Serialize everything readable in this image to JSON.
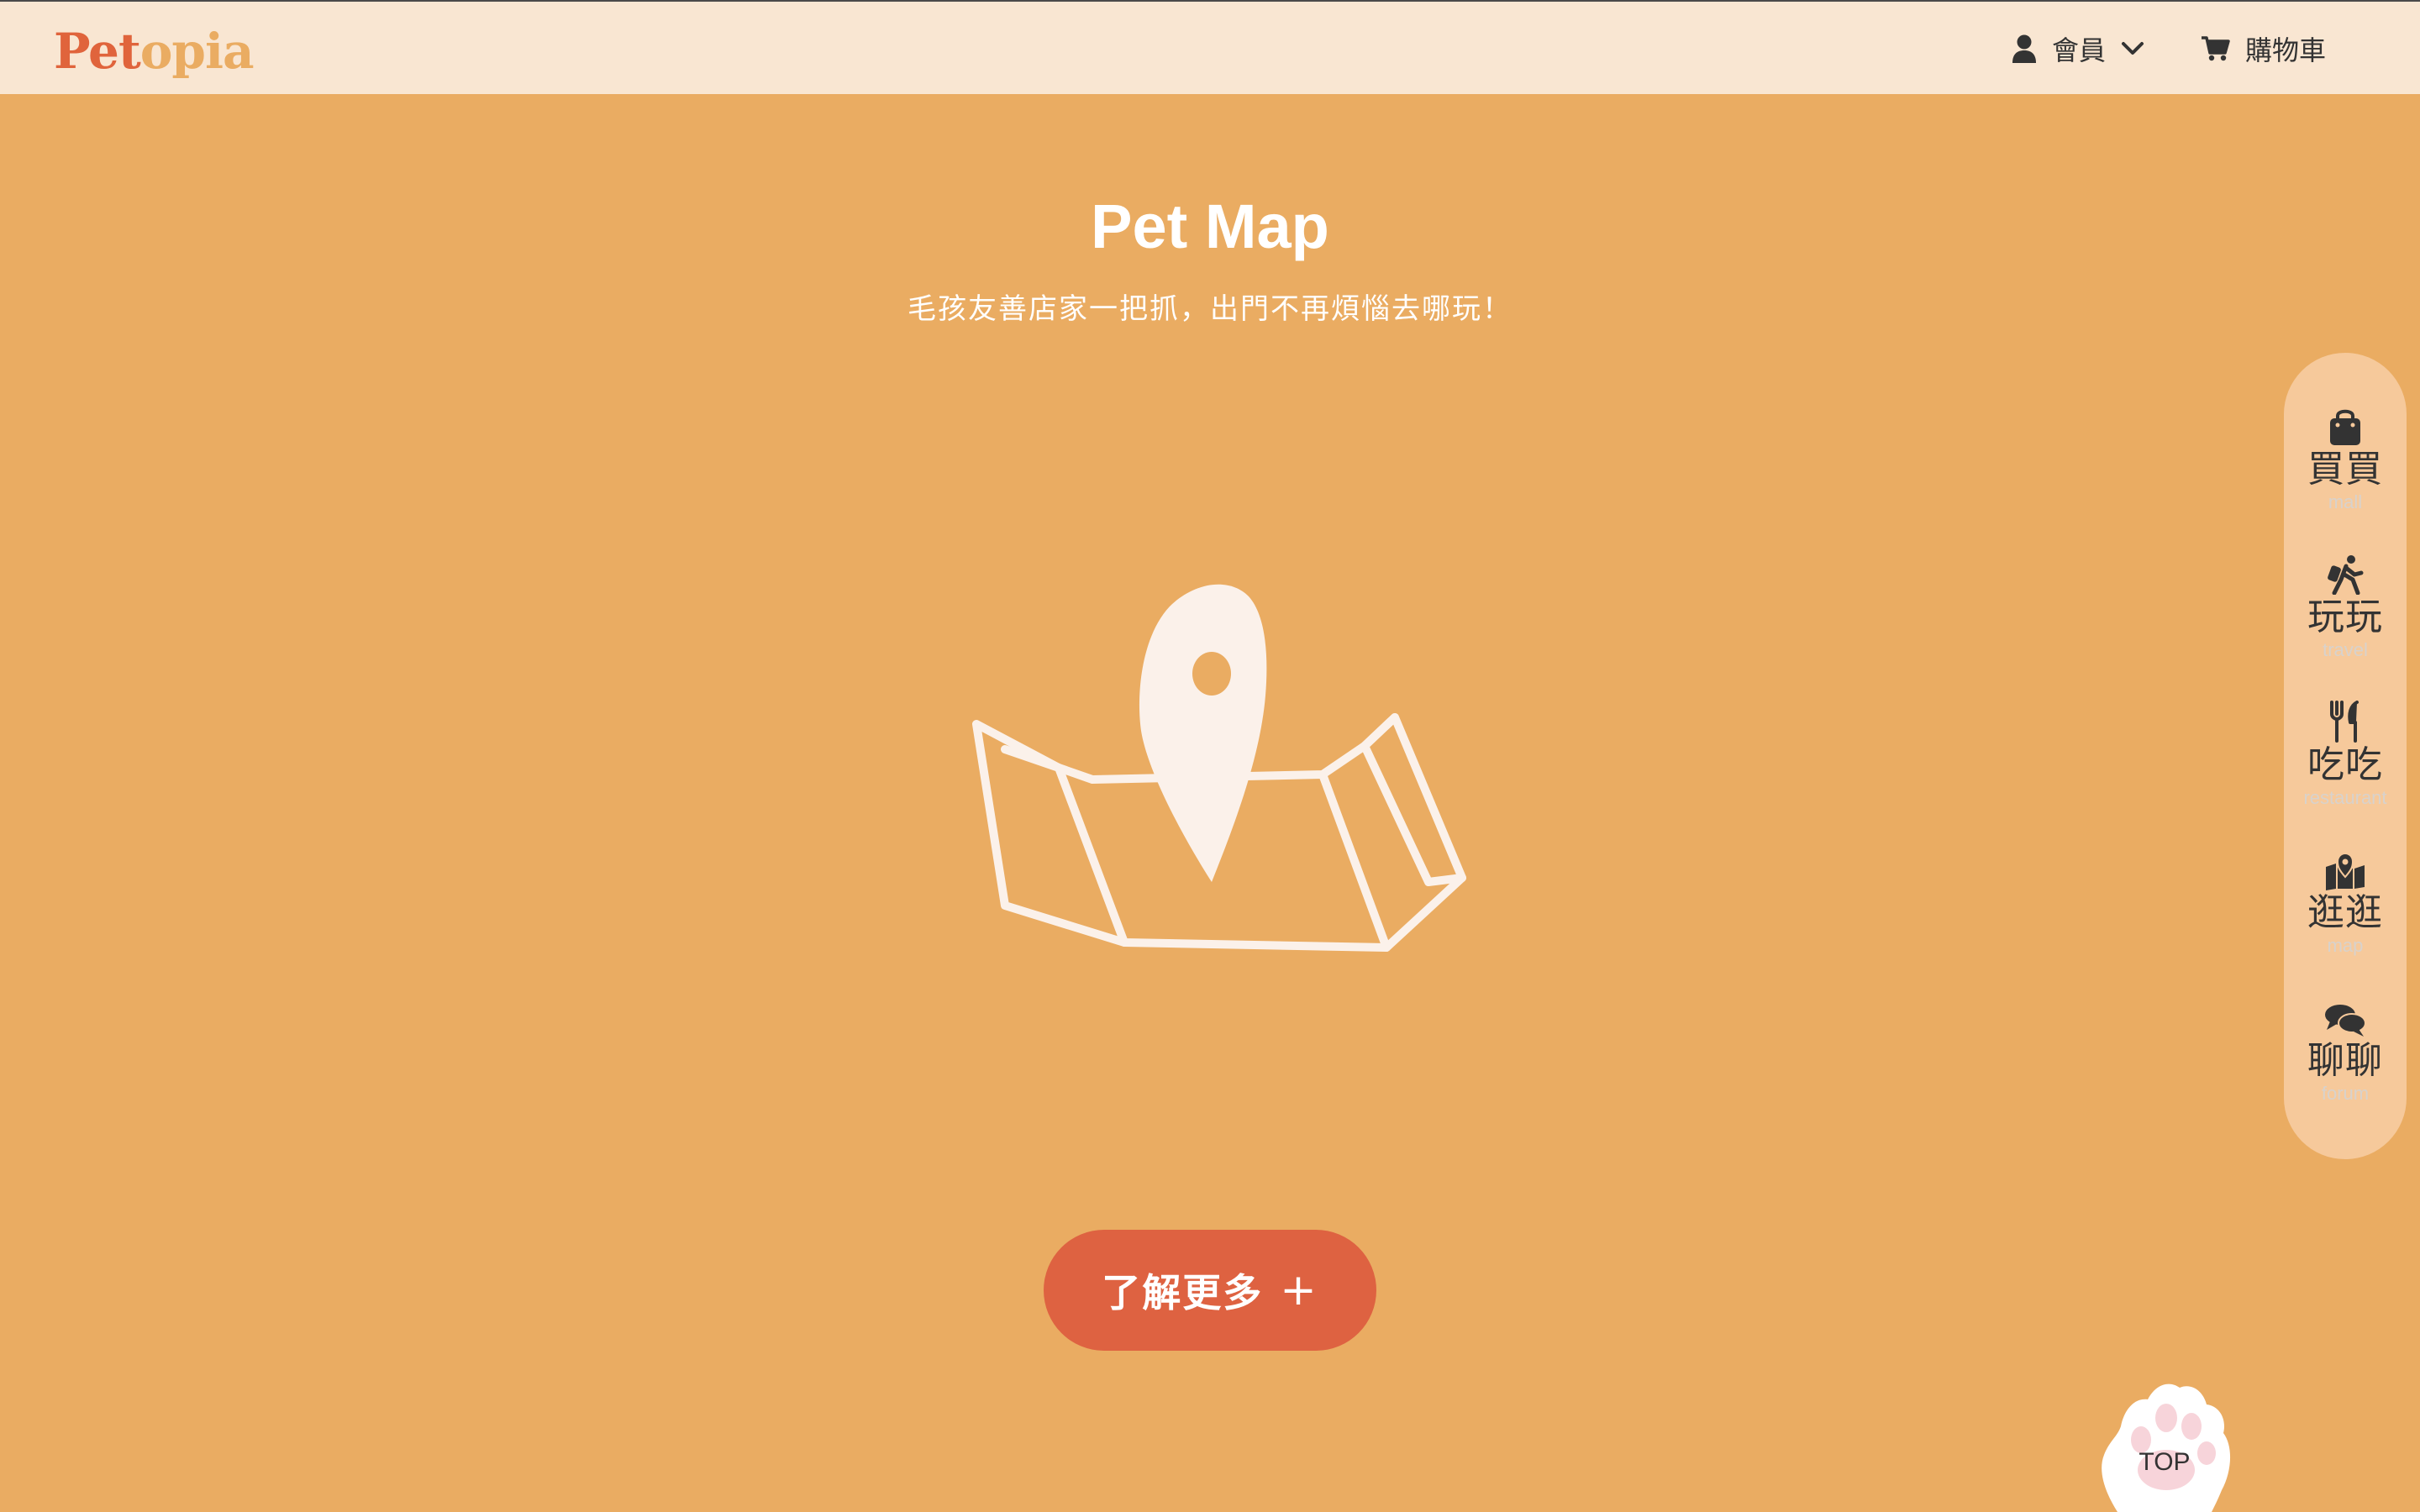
{
  "header": {
    "logo": {
      "part1": "Pet",
      "part2": "opia"
    },
    "member_label": "會員",
    "cart_label": "購物車"
  },
  "hero": {
    "title": "Pet Map",
    "subtitle": "毛孩友善店家一把抓，出門不再煩惱去哪玩！",
    "cta_label": "了解更多",
    "cta_icon": "+"
  },
  "side_nav": {
    "items": [
      {
        "icon": "shopping-bag-icon",
        "label": "買買",
        "sub": "mall"
      },
      {
        "icon": "hiking-icon",
        "label": "玩玩",
        "sub": "travel"
      },
      {
        "icon": "utensils-icon",
        "label": "吃吃",
        "sub": "restaurant"
      },
      {
        "icon": "map-marked-icon",
        "label": "逛逛",
        "sub": "map"
      },
      {
        "icon": "comments-icon",
        "label": "聊聊",
        "sub": "forum"
      }
    ]
  },
  "top_button": {
    "label": "TOP"
  },
  "colors": {
    "background": "#EAAC62",
    "header": "#F9E6D2",
    "accent": "#DE6241",
    "side_nav": "#F6C99B",
    "text_dark": "#333333"
  }
}
